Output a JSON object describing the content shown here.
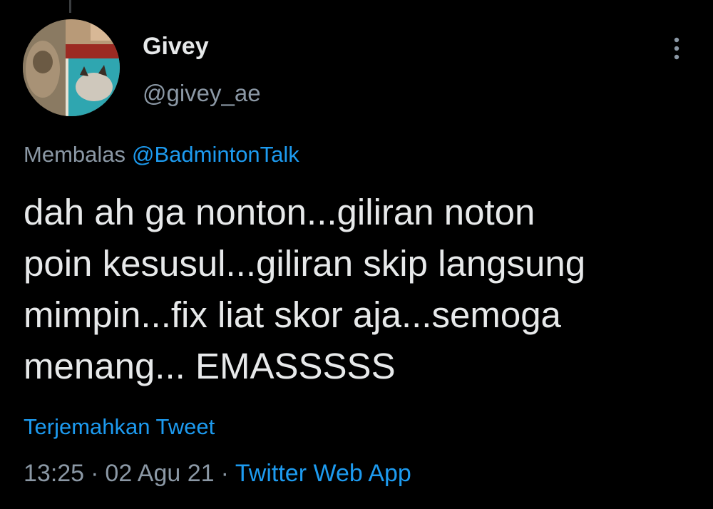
{
  "user": {
    "display_name": "Givey",
    "handle": "@givey_ae",
    "avatar_icon": "cat-photo-avatar"
  },
  "reply": {
    "prefix": "Membalas",
    "mention": "@BadmintonTalk"
  },
  "tweet": {
    "lines": [
      "dah ah ga nonton...giliran noton",
      "poin kesusul...giliran skip langsung",
      "mimpin...fix liat skor aja...semoga",
      "menang... EMASSSSS"
    ]
  },
  "translate_label": "Terjemahkan Tweet",
  "meta": {
    "time": "13:25",
    "separator": "·",
    "date": "02 Agu 21",
    "source": "Twitter Web App"
  },
  "more_icon": "more-vertical-icon",
  "colors": {
    "background": "#000000",
    "primary_text": "#e7e9ea",
    "secondary_text": "#8b98a5",
    "link": "#1d9bf0"
  }
}
